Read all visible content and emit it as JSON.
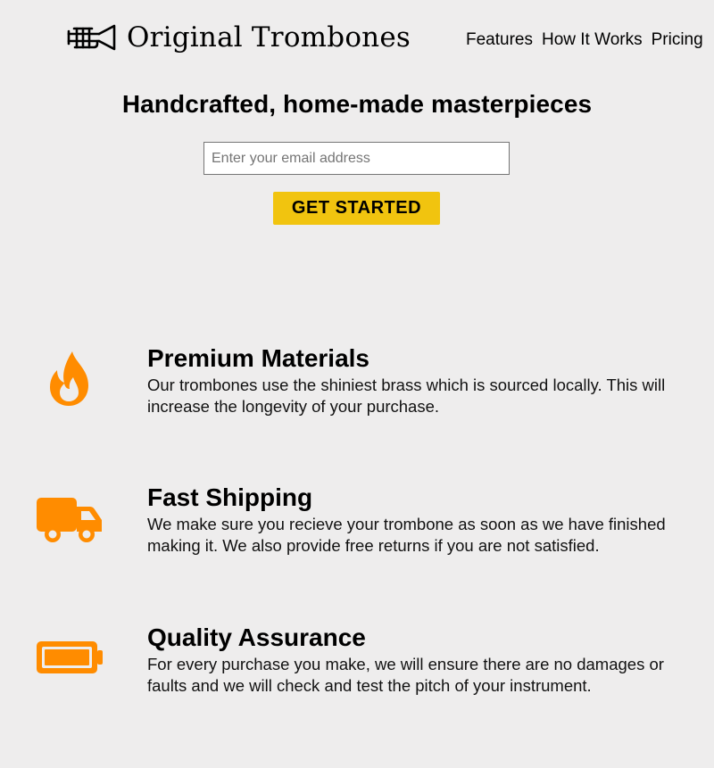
{
  "header": {
    "logo_icon": "trumpet-icon",
    "brand_name": "Original Trombones",
    "nav": [
      "Features",
      "How It Works",
      "Pricing"
    ]
  },
  "hero": {
    "title": "Handcrafted, home-made masterpieces",
    "email_placeholder": "Enter your email address",
    "cta_label": "GET STARTED"
  },
  "features": [
    {
      "icon": "fire-icon",
      "title": "Premium Materials",
      "description": "Our trombones use the shiniest brass which is sourced locally. This will increase the longevity of your purchase."
    },
    {
      "icon": "truck-icon",
      "title": "Fast Shipping",
      "description": "We make sure you recieve your trombone as soon as we have finished making it. We also provide free returns if you are not satisfied."
    },
    {
      "icon": "battery-icon",
      "title": "Quality Assurance",
      "description": "For every purchase you make, we will ensure there are no damages or faults and we will check and test the pitch of your instrument."
    }
  ],
  "colors": {
    "background": "#eeeded",
    "accent_orange": "#ff8c00",
    "button_yellow": "#f1c40f"
  }
}
